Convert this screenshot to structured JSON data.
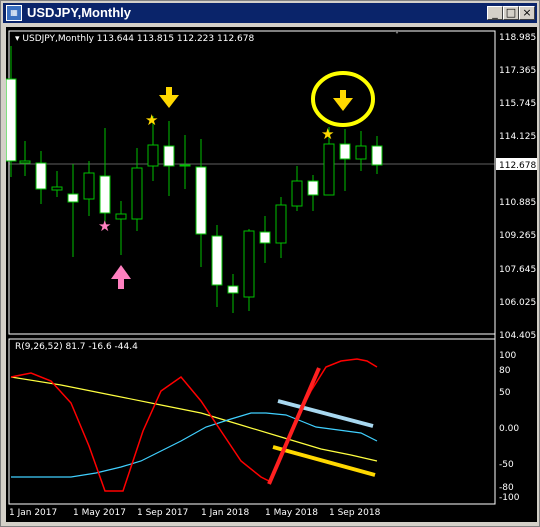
{
  "window": {
    "title": "USDJPY,Monthly",
    "minimize_glyph": "_",
    "restore_glyph": "□",
    "close_glyph": "×"
  },
  "price_panel": {
    "header": "USDJPY,Monthly  113.644 113.815 112.223 112.678",
    "price_axis": [
      "118.985",
      "117.365",
      "115.745",
      "114.125",
      "112.678",
      "110.885",
      "109.265",
      "107.645",
      "106.025",
      "104.405"
    ],
    "current_price": "112.678"
  },
  "indicator_panel": {
    "header": "R(9,26,52) 81.7 -16.6 -44.4",
    "axis": [
      "100",
      "80",
      "50",
      "0.00",
      "-50",
      "-80",
      "-100"
    ]
  },
  "time_axis": [
    "1 Jan 2017",
    "1 May 2017",
    "1 Sep 2017",
    "1 Jan 2018",
    "1 May 2018",
    "1 Sep 2018"
  ],
  "annotations": {
    "stars": 3,
    "up_arrow_color": "#ff80c0",
    "down_arrow_color": "#ffd800",
    "circle_color": "#ffff00"
  },
  "colors": {
    "bull_candle": "#000000",
    "bear_candle": "#ffffff",
    "wick": "#00c000",
    "line_red": "#ff0000",
    "line_yellow": "#ffff40",
    "line_cyan": "#40d0ff"
  }
}
